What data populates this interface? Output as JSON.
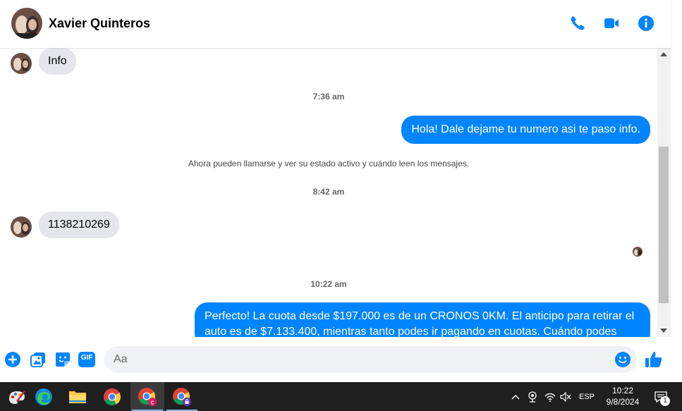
{
  "header": {
    "contact_name": "Xavier Quinteros",
    "icons": [
      "phone-icon",
      "video-icon",
      "info-icon"
    ]
  },
  "messages": {
    "incoming_1": "Info",
    "timestamp_1": "7:36 am",
    "outgoing_1": "Hola! Dale dejame tu numero  asi te paso info.",
    "system_1": "Ahora pueden llamarse y ver su estado activo y cuándo leen los mensajes.",
    "timestamp_2": "8:42 am",
    "incoming_2": "1138210269",
    "timestamp_3": "10:22 am",
    "outgoing_2": "Perfecto! La cuota desde $197.000 es de un CRONOS 0KM. El anticipo para retirar el auto es de $7.133.400, mientras tanto podes ir pagando en cuotas. Cuándo podes"
  },
  "composer": {
    "placeholder": "Aa",
    "icons": [
      "plus-icon",
      "photo-icon",
      "sticker-icon",
      "gif-icon",
      "emoji-icon",
      "like-icon"
    ],
    "gif_label": "GIF"
  },
  "taskbar": {
    "apps": [
      "paint-icon",
      "edge-icon",
      "file-explorer-icon",
      "chrome-icon",
      "chrome-profile-c-icon",
      "chrome-profile-lock-icon"
    ],
    "language": "ESP",
    "time": "10:22",
    "date": "9/8/2024",
    "notification_count": "1"
  },
  "colors": {
    "accent": "#0084ff",
    "incoming_bubble": "#e4e6eb",
    "taskbar": "#1f1f1f"
  }
}
